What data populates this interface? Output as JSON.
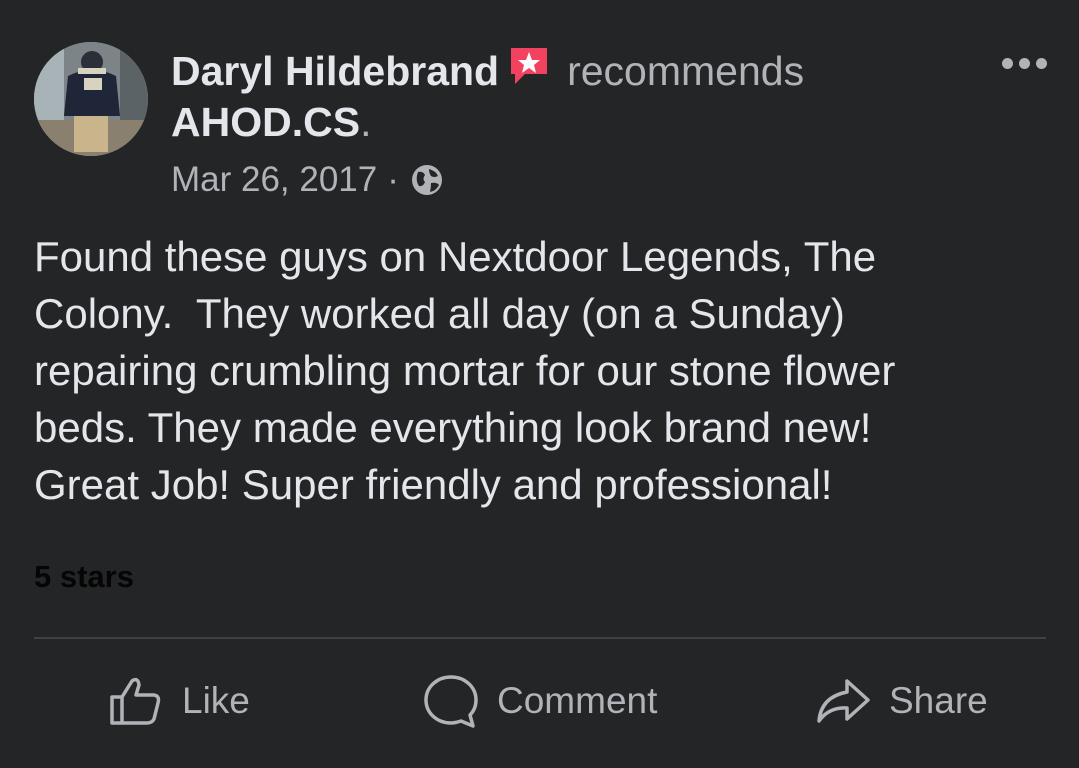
{
  "post": {
    "author": "Daryl Hildebrand",
    "action_text": "recommends",
    "page_name": "AHOD.CS",
    "page_name_suffix": ".",
    "date": "Mar 26, 2017",
    "separator": "·",
    "visibility_icon": "globe-icon",
    "badge_icon": "recommendation-star-icon",
    "body": "Found these guys on Nextdoor Legends, The\nColony.  They worked all day (on a Sunday)\nrepairing crumbling mortar for our stone flower\nbeds. They made everything look brand new!\nGreat Job! Super friendly and professional!",
    "rating_text": "5 stars",
    "rating_value": 5
  },
  "actions": {
    "like_label": "Like",
    "comment_label": "Comment",
    "share_label": "Share"
  },
  "colors": {
    "background": "#242526",
    "primary_text": "#e4e6eb",
    "secondary_text": "#b0b3b8",
    "divider": "#3e4042",
    "badge": "#f3425f"
  }
}
